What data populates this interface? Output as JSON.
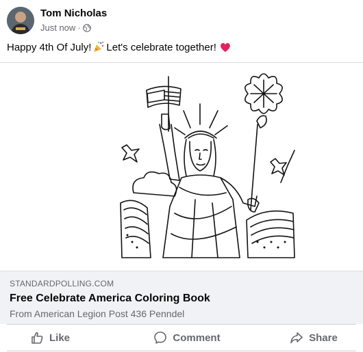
{
  "post": {
    "author": "Tom Nicholas",
    "timestamp": "Just now",
    "separator": "·",
    "audience_icon": "globe-icon",
    "text_part1": "Happy 4th Of July!",
    "text_part2": "Let's celebrate together!",
    "emoji_1": "party-popper-icon",
    "emoji_2": "red-heart-icon"
  },
  "link_preview": {
    "domain": "STANDARDPOLLING.COM",
    "title": "Free Celebrate America Coloring Book",
    "description": "From American Legion Post 436 Penndel"
  },
  "actions": {
    "like_label": "Like",
    "comment_label": "Comment",
    "share_label": "Share"
  },
  "colors": {
    "secondary_text": "#65676b",
    "link_box_bg": "#f0f2f5",
    "heart": "#e0245e"
  }
}
